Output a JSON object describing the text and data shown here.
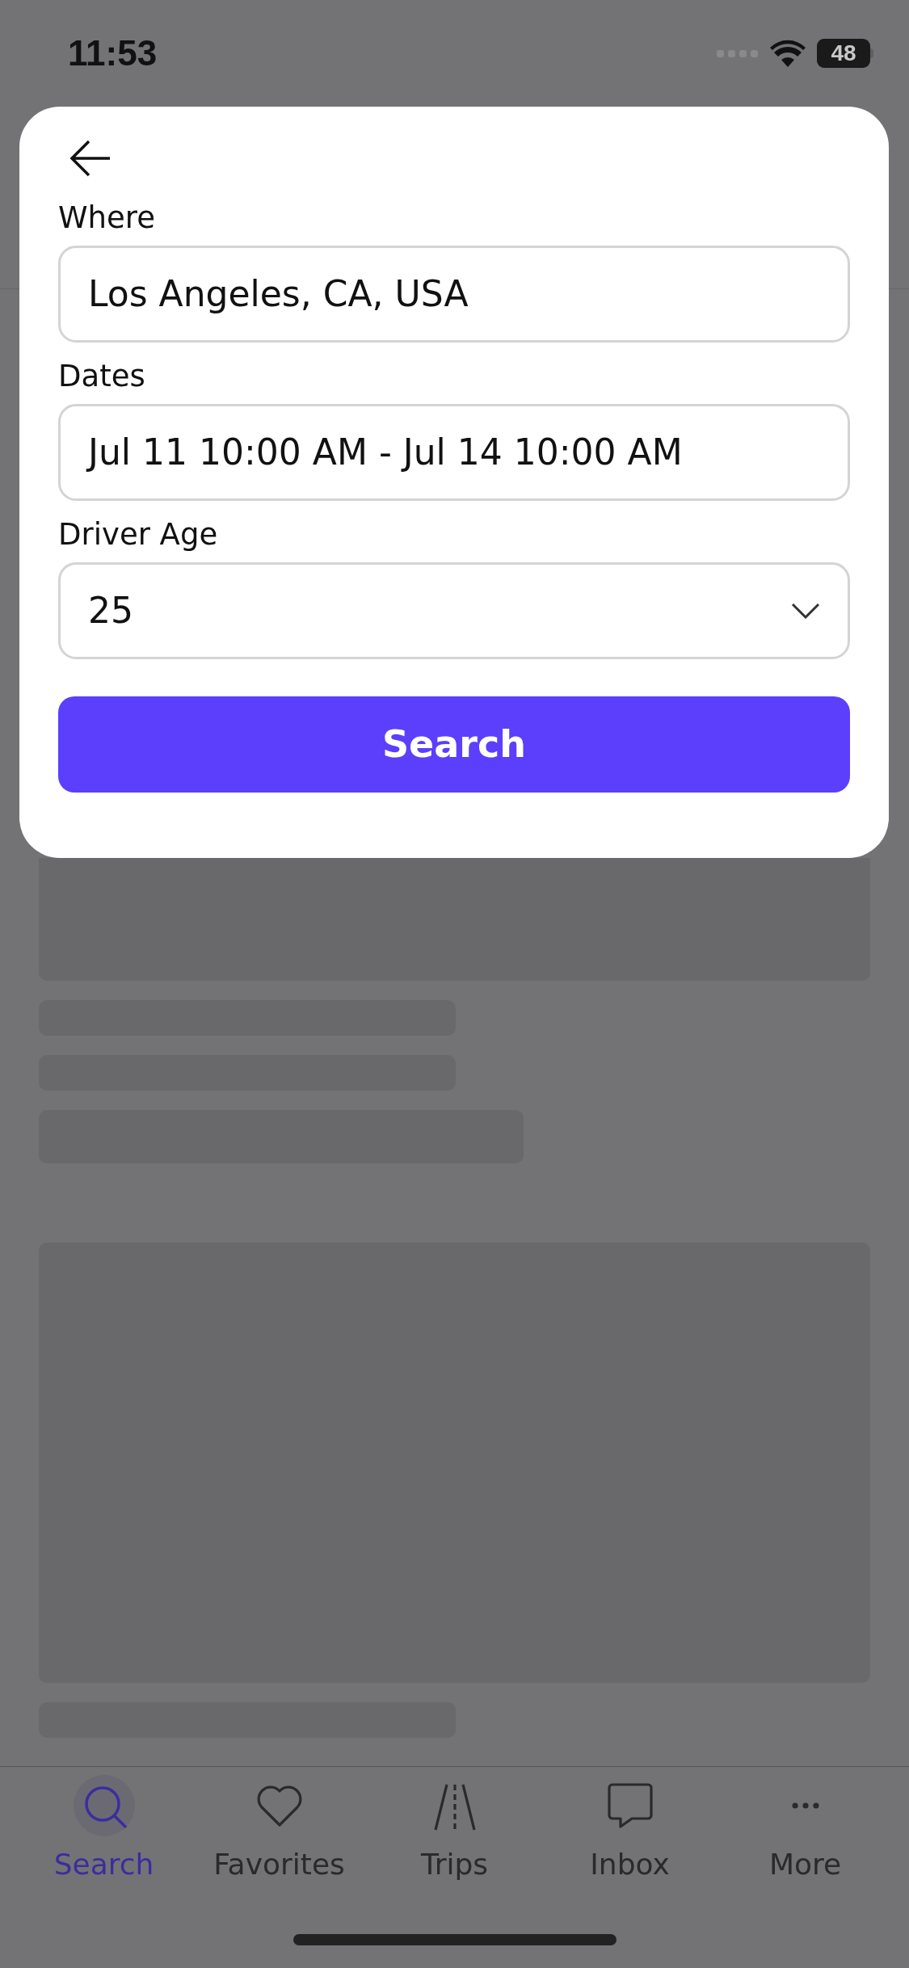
{
  "status_bar": {
    "time": "11:53",
    "battery": "48"
  },
  "search_form": {
    "fields": [
      {
        "label": "Where",
        "value": "Los Angeles, CA, USA",
        "kind": "text"
      },
      {
        "label": "Dates",
        "value": "Jul 11 10:00 AM - Jul 14 10:00 AM",
        "kind": "text"
      },
      {
        "label": "Driver Age",
        "value": "25",
        "kind": "dropdown"
      }
    ],
    "button": "Search"
  },
  "tab_bar": [
    {
      "label": "Search",
      "kind": "search",
      "selected": true
    },
    {
      "label": "Favorites",
      "kind": "heart",
      "selected": false
    },
    {
      "label": "Trips",
      "kind": "road",
      "selected": false
    },
    {
      "label": "Inbox",
      "kind": "chat",
      "selected": false
    },
    {
      "label": "More",
      "kind": "more",
      "selected": false
    }
  ]
}
